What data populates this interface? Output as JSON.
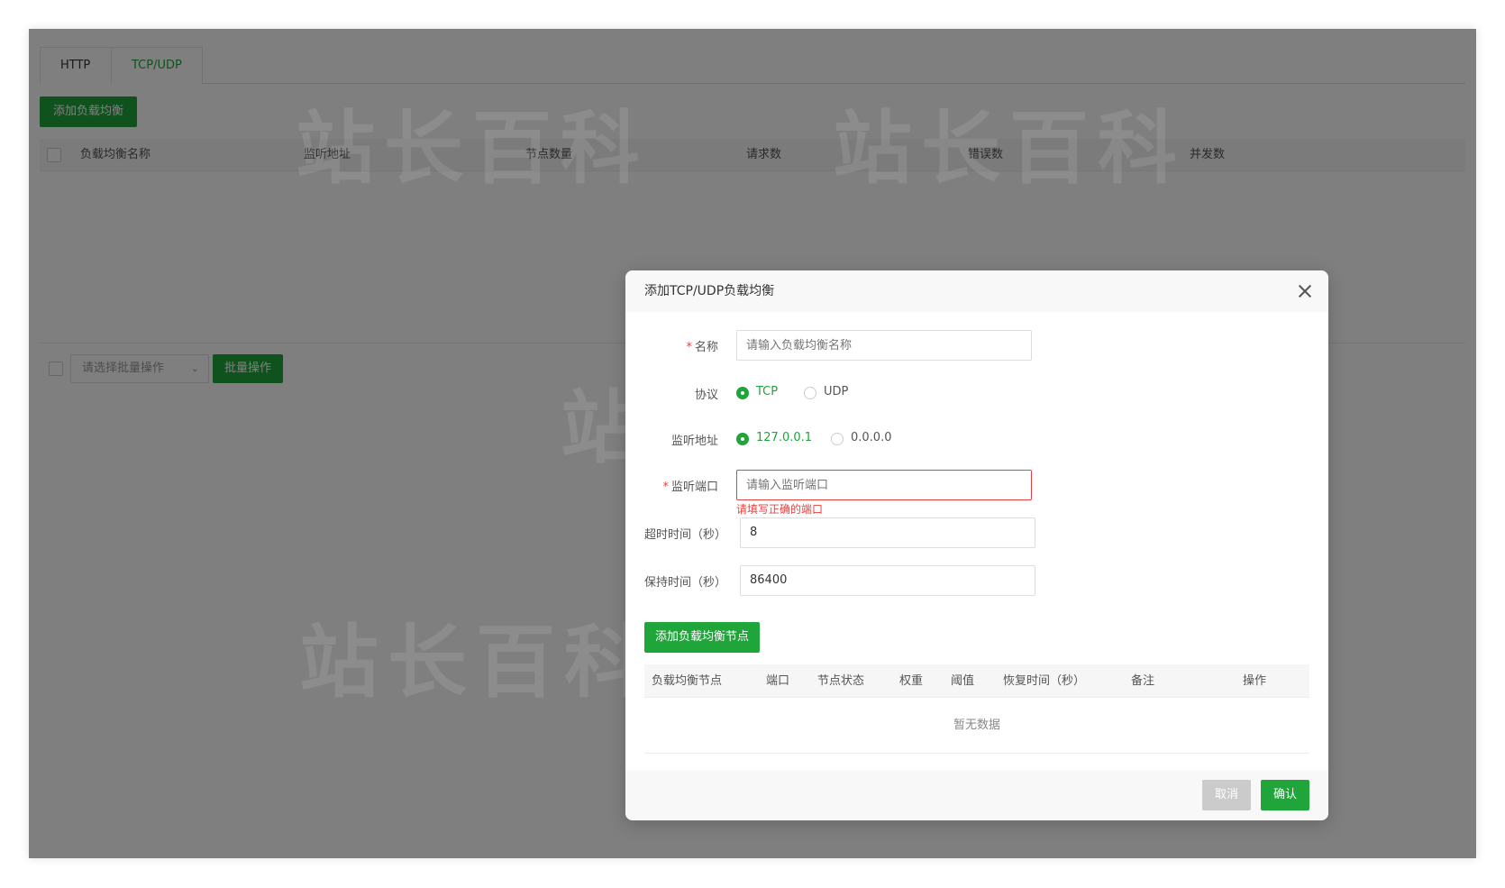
{
  "tabs": [
    {
      "label": "HTTP",
      "active": false
    },
    {
      "label": "TCP/UDP",
      "active": true
    }
  ],
  "toolbar": {
    "add_label": "添加负载均衡"
  },
  "table": {
    "headers": [
      "负载均衡名称",
      "监听地址",
      "节点数量",
      "请求数",
      "错误数",
      "并发数"
    ]
  },
  "batch": {
    "select_placeholder": "请选择批量操作",
    "button_label": "批量操作"
  },
  "watermark": {
    "text": "站长百科"
  },
  "modal": {
    "title": "添加TCP/UDP负载均衡",
    "fields": {
      "name": {
        "label": "名称",
        "required": true,
        "placeholder": "请输入负载均衡名称"
      },
      "protocol": {
        "label": "协议",
        "options": [
          "TCP",
          "UDP"
        ],
        "selected": "TCP"
      },
      "listen_addr": {
        "label": "监听地址",
        "options": [
          "127.0.0.1",
          "0.0.0.0"
        ],
        "selected": "127.0.0.1"
      },
      "listen_port": {
        "label": "监听端口",
        "required": true,
        "placeholder": "请输入监听端口",
        "error": "请填写正确的端口"
      },
      "timeout": {
        "label": "超时时间（秒）",
        "value": "8"
      },
      "keepalive": {
        "label": "保持时间（秒）",
        "value": "86400"
      }
    },
    "add_node_label": "添加负载均衡节点",
    "node_table": {
      "headers": [
        "负载均衡节点",
        "端口",
        "节点状态",
        "权重",
        "阈值",
        "恢复时间（秒）",
        "备注",
        "操作"
      ],
      "empty_text": "暂无数据"
    },
    "footer": {
      "cancel_label": "取消",
      "confirm_label": "确认"
    }
  },
  "colors": {
    "accent": "#20a53a",
    "error": "#e84040",
    "overlay": "rgba(0,0,0,0.5)"
  }
}
